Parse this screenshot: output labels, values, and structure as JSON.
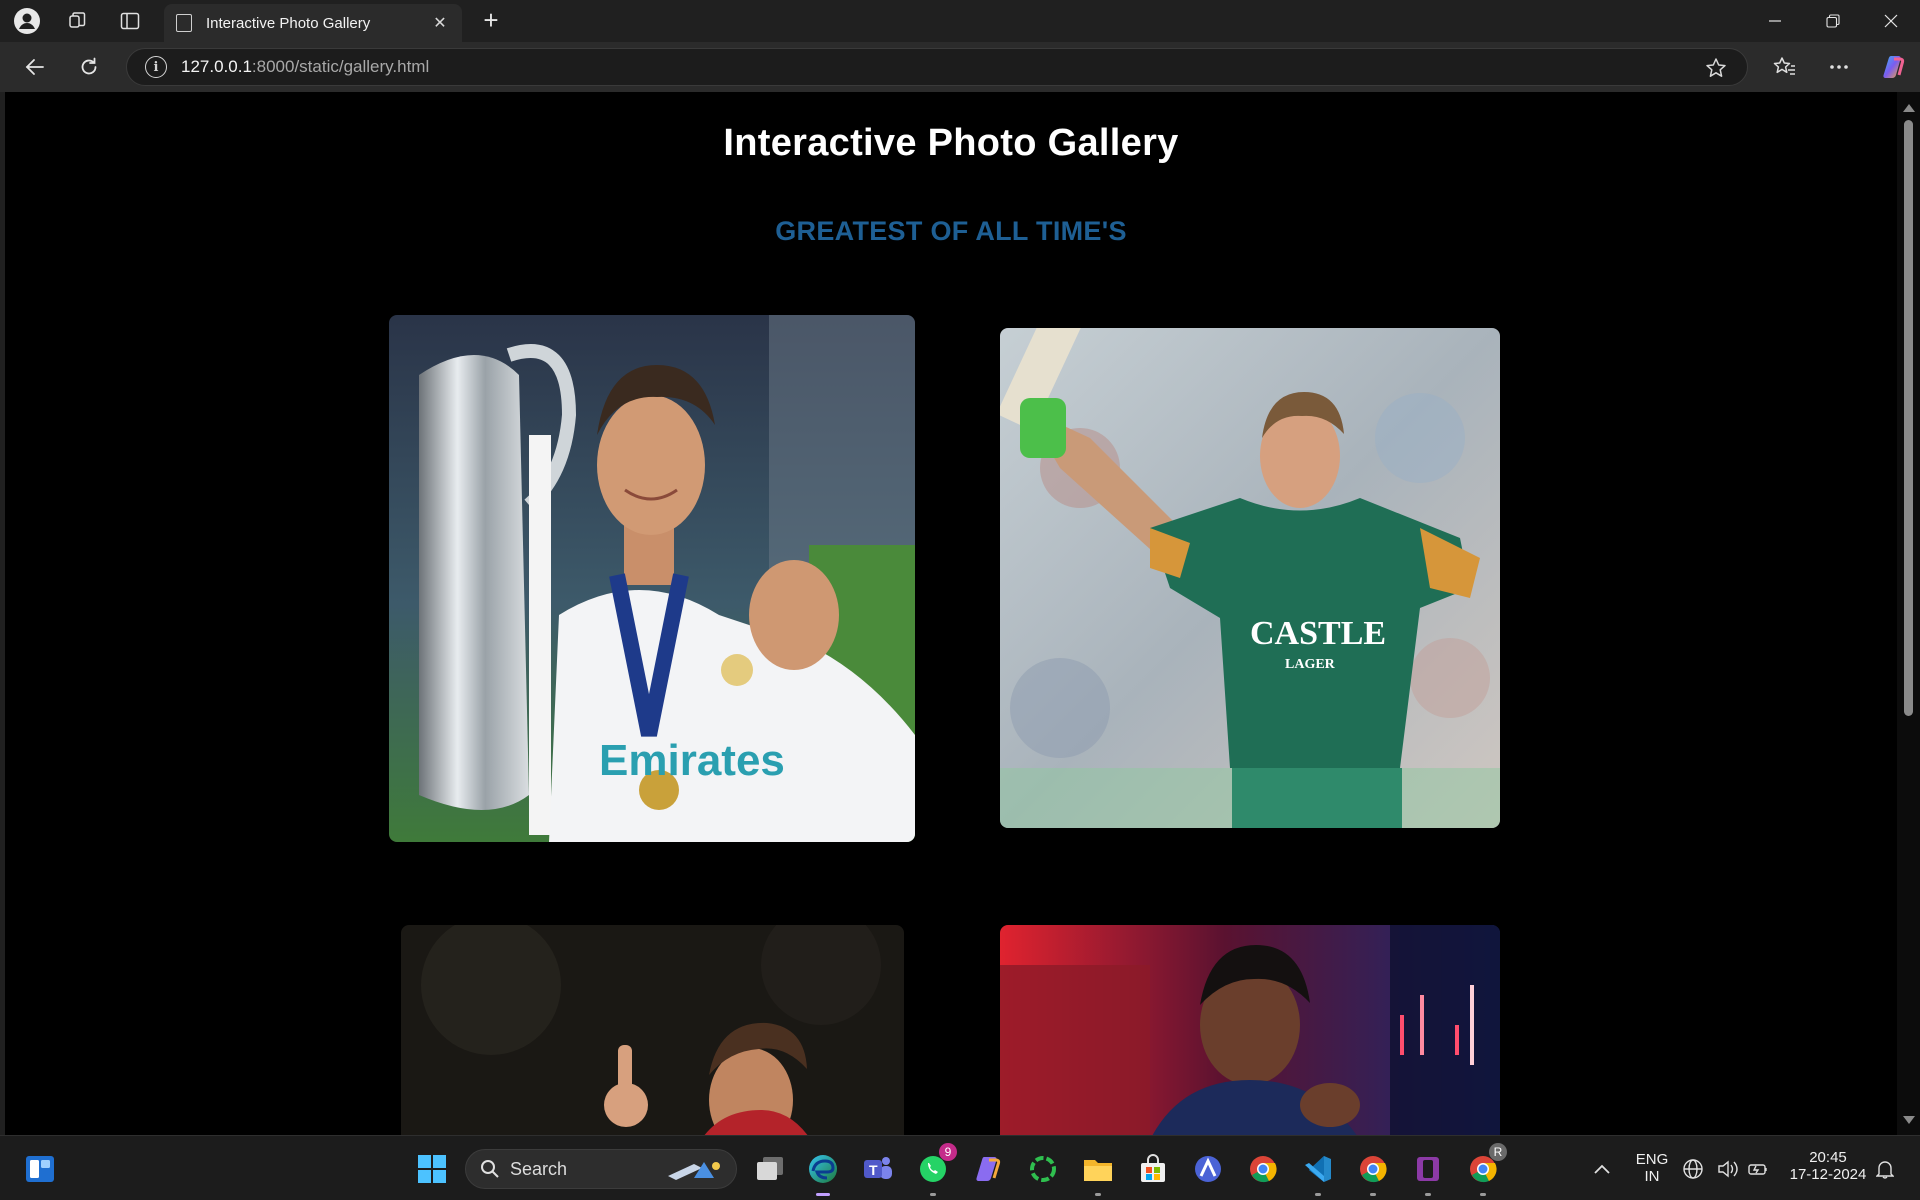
{
  "browser": {
    "tab_title": "Interactive Photo Gallery",
    "url_host": "127.0.0.1",
    "url_path": ":8000/static/gallery.html",
    "close_glyph": "✕",
    "new_tab_glyph": "+"
  },
  "page": {
    "title": "Interactive Photo Gallery",
    "subtitle": "GREATEST OF ALL TIME'S",
    "subtitle_color": "#1e5f94",
    "photos": [
      {
        "subject": "footballer-with-trophy",
        "jersey_text": "Emirates"
      },
      {
        "subject": "cricketer-raising-bat",
        "jersey_text": "CASTLE",
        "jersey_subtext": "LAGER"
      },
      {
        "subject": "footballer-pointing"
      },
      {
        "subject": "man-in-car"
      }
    ]
  },
  "taskbar": {
    "search_placeholder": "Search",
    "whatsapp_badge": "9",
    "chrome_profile_badge": "R",
    "language_line1": "ENG",
    "language_line2": "IN",
    "time": "20:45",
    "date": "17-12-2024"
  },
  "colors": {
    "page_background": "#000000",
    "chrome_dark": "#202020",
    "accent_blue": "#1e5f94"
  }
}
